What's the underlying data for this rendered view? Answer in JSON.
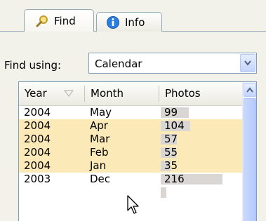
{
  "tabs": [
    {
      "label": "Find",
      "icon": "magnifier-icon",
      "active": true
    },
    {
      "label": "Info",
      "icon": "info-icon",
      "active": false
    }
  ],
  "find": {
    "label": "Find using:",
    "selected": "Calendar"
  },
  "table": {
    "columns": [
      "Year",
      "Month",
      "Photos"
    ],
    "rows": [
      {
        "year": "2004",
        "month": "May",
        "photos": "99",
        "selected": false,
        "level": 99
      },
      {
        "year": "2004",
        "month": "Apr",
        "photos": "104",
        "selected": true,
        "level": 104
      },
      {
        "year": "2004",
        "month": "Mar",
        "photos": "57",
        "selected": true,
        "level": 57
      },
      {
        "year": "2004",
        "month": "Feb",
        "photos": "55",
        "selected": true,
        "level": 55
      },
      {
        "year": "2004",
        "month": "Jan",
        "photos": "35",
        "selected": true,
        "level": 35
      },
      {
        "year": "2003",
        "month": "Dec",
        "photos": "216",
        "selected": false,
        "level": 216
      },
      {
        "year": "",
        "month": "",
        "photos": "",
        "selected": false,
        "level": 20
      }
    ]
  },
  "colors": {
    "selection": "#fce9b8",
    "bar": "#d9d6d4",
    "border": "#7f9db9"
  }
}
